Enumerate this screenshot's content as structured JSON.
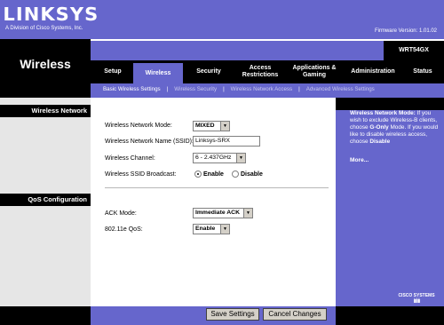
{
  "brand": {
    "logo": "LINKSYS",
    "subtitle": "A Division of Cisco Systems, Inc.",
    "firmware": "Firmware Version: 1.01.02",
    "model": "WRT54GX"
  },
  "page_title": "Wireless",
  "tabs": [
    {
      "label": "Setup",
      "active": false
    },
    {
      "label": "Wireless",
      "active": true
    },
    {
      "label": "Security",
      "active": false
    },
    {
      "label": "Access Restrictions",
      "active": false
    },
    {
      "label": "Applications & Gaming",
      "active": false
    },
    {
      "label": "Administration",
      "active": false
    },
    {
      "label": "Status",
      "active": false
    }
  ],
  "subtabs": [
    {
      "label": "Basic Wireless Settings",
      "active": true
    },
    {
      "label": "Wireless Security",
      "active": false
    },
    {
      "label": "Wireless Network Access",
      "active": false
    },
    {
      "label": "Advanced Wireless Settings",
      "active": false
    }
  ],
  "sections": {
    "wireless_network": "Wireless Network",
    "qos": "QoS Configuration"
  },
  "form": {
    "mode_label": "Wireless Network Mode:",
    "mode_value": "MIXED",
    "ssid_label": "Wireless Network Name (SSID):",
    "ssid_value": "Linksys-SRX",
    "channel_label": "Wireless Channel:",
    "channel_value": "6 - 2.437GHz",
    "broadcast_label": "Wireless SSID Broadcast:",
    "broadcast_enable": "Enable",
    "broadcast_disable": "Disable",
    "broadcast_selected": "Enable",
    "ack_label": "ACK Mode:",
    "ack_value": "Immediate ACK",
    "qos_label": "802.11e QoS:",
    "qos_value": "Enable"
  },
  "help": {
    "title": "Wireless Network Mode:",
    "body1": " If you wish to exclude Wireless-B clients, choose ",
    "gonly": "G-Only",
    "body2": " Mode. If you would like to disable wireless access, choose ",
    "disable": "Disable",
    "more": "More..."
  },
  "footer": {
    "cisco": "CISCO SYSTEMS",
    "save": "Save Settings",
    "cancel": "Cancel Changes"
  },
  "colors": {
    "brand_purple": "#6666cc",
    "black": "#000000",
    "panel_gray": "#e6e6e6"
  }
}
